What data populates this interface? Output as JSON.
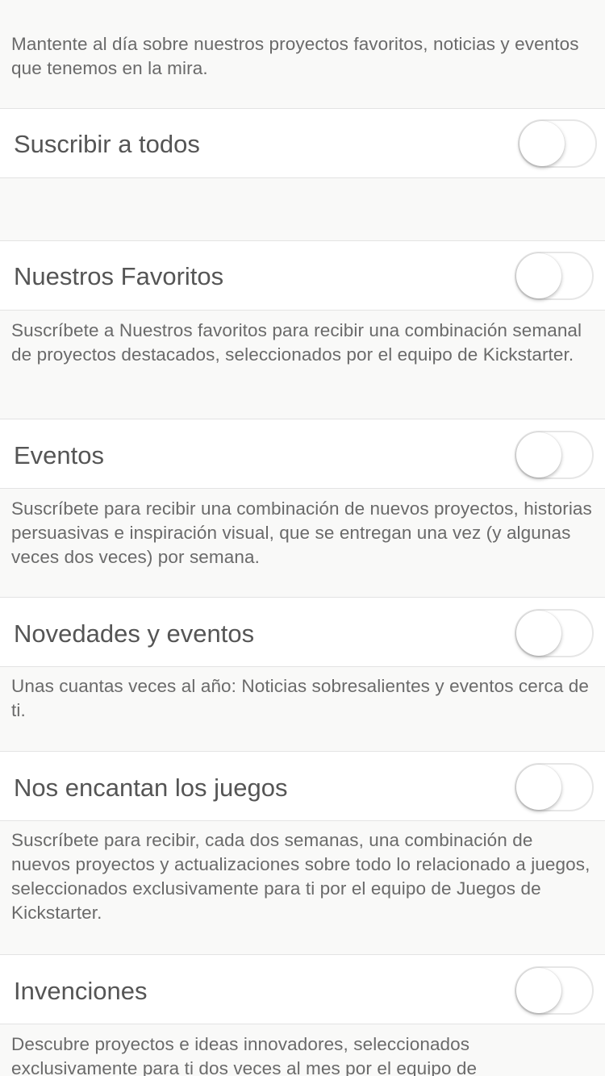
{
  "intro_text": "Mantente al día sobre nuestros proyectos favoritos, noticias y eventos que tenemos en la mira.",
  "subscribe_all": {
    "label": "Suscribir a todos",
    "enabled": false
  },
  "newsletters": [
    {
      "label": "Nuestros Favoritos",
      "enabled": false,
      "description": "Suscríbete a Nuestros favoritos para recibir una combinación semanal de proyectos destacados, seleccionados por el equipo de Kickstarter."
    },
    {
      "label": "Eventos",
      "enabled": false,
      "description": "Suscríbete para recibir una combinación de nuevos proyectos, historias persuasivas e inspiración visual, que se entregan una vez (y algunas veces dos veces) por semana."
    },
    {
      "label": "Novedades y eventos",
      "enabled": false,
      "description": "Unas cuantas veces al año: Noticias sobresalientes y eventos cerca de ti."
    },
    {
      "label": "Nos encantan los juegos",
      "enabled": false,
      "description": "Suscríbete para recibir, cada dos semanas, una combinación de nuevos proyectos y actualizaciones sobre todo lo relacionado a juegos, seleccionados exclusivamente para ti por el equipo de Juegos de Kickstarter."
    },
    {
      "label": "Invenciones",
      "enabled": false,
      "description": "Descubre proyectos e ideas innovadores, seleccionados exclusivamente para ti dos veces al mes por el equipo de"
    }
  ],
  "colors": {
    "background": "#f9f9f8",
    "row_background": "#ffffff",
    "divider": "#e3e3e3",
    "toggle_off_border": "#e6e6e6"
  }
}
